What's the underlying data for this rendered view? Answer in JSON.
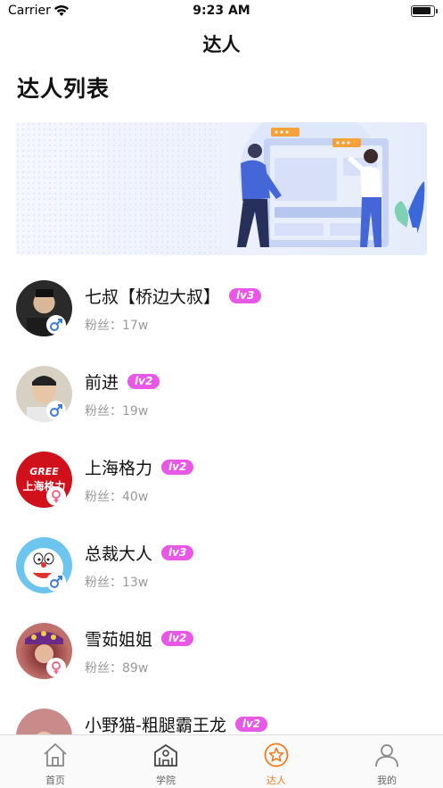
{
  "status_bar": {
    "carrier": "Carrier",
    "time": "9:23 AM",
    "battery_level": 0.95
  },
  "nav": {
    "title": "达人"
  },
  "section": {
    "title": "达人列表"
  },
  "banner": {
    "alt_icon": "team-collaboration-illustration"
  },
  "experts": [
    {
      "name": "七叔【桥边大叔】",
      "level": "lv3",
      "fans": "粉丝：17w",
      "gender": "male",
      "avatar_color": "#2a2a2a"
    },
    {
      "name": "前进",
      "level": "lv2",
      "fans": "粉丝：19w",
      "gender": "male",
      "avatar_color": "#d9c7b0"
    },
    {
      "name": "上海格力",
      "level": "lv2",
      "fans": "粉丝：40w",
      "gender": "female",
      "avatar_color": "#d0101a",
      "avatar_text_top": "GREE",
      "avatar_text_bottom": "上海格力"
    },
    {
      "name": "总裁大人",
      "level": "lv3",
      "fans": "粉丝：13w",
      "gender": "male",
      "avatar_color": "#6cc5ef"
    },
    {
      "name": "雪茹姐姐",
      "level": "lv2",
      "fans": "粉丝：89w",
      "gender": "female",
      "avatar_color": "#a0504a"
    },
    {
      "name": "小野猫-粗腿霸王龙",
      "level": "lv2",
      "fans": "",
      "gender": "",
      "avatar_color": "#c98a8a"
    }
  ],
  "tabbar": [
    {
      "label": "首页",
      "icon": "home-icon",
      "active": false
    },
    {
      "label": "学院",
      "icon": "academy-icon",
      "active": false
    },
    {
      "label": "达人",
      "icon": "star-icon",
      "active": true
    },
    {
      "label": "我的",
      "icon": "profile-icon",
      "active": false
    }
  ],
  "colors": {
    "accent": "#f47a1e",
    "level_badge": "#e957e6",
    "male": "#3b7be0",
    "female": "#f06a8a"
  }
}
